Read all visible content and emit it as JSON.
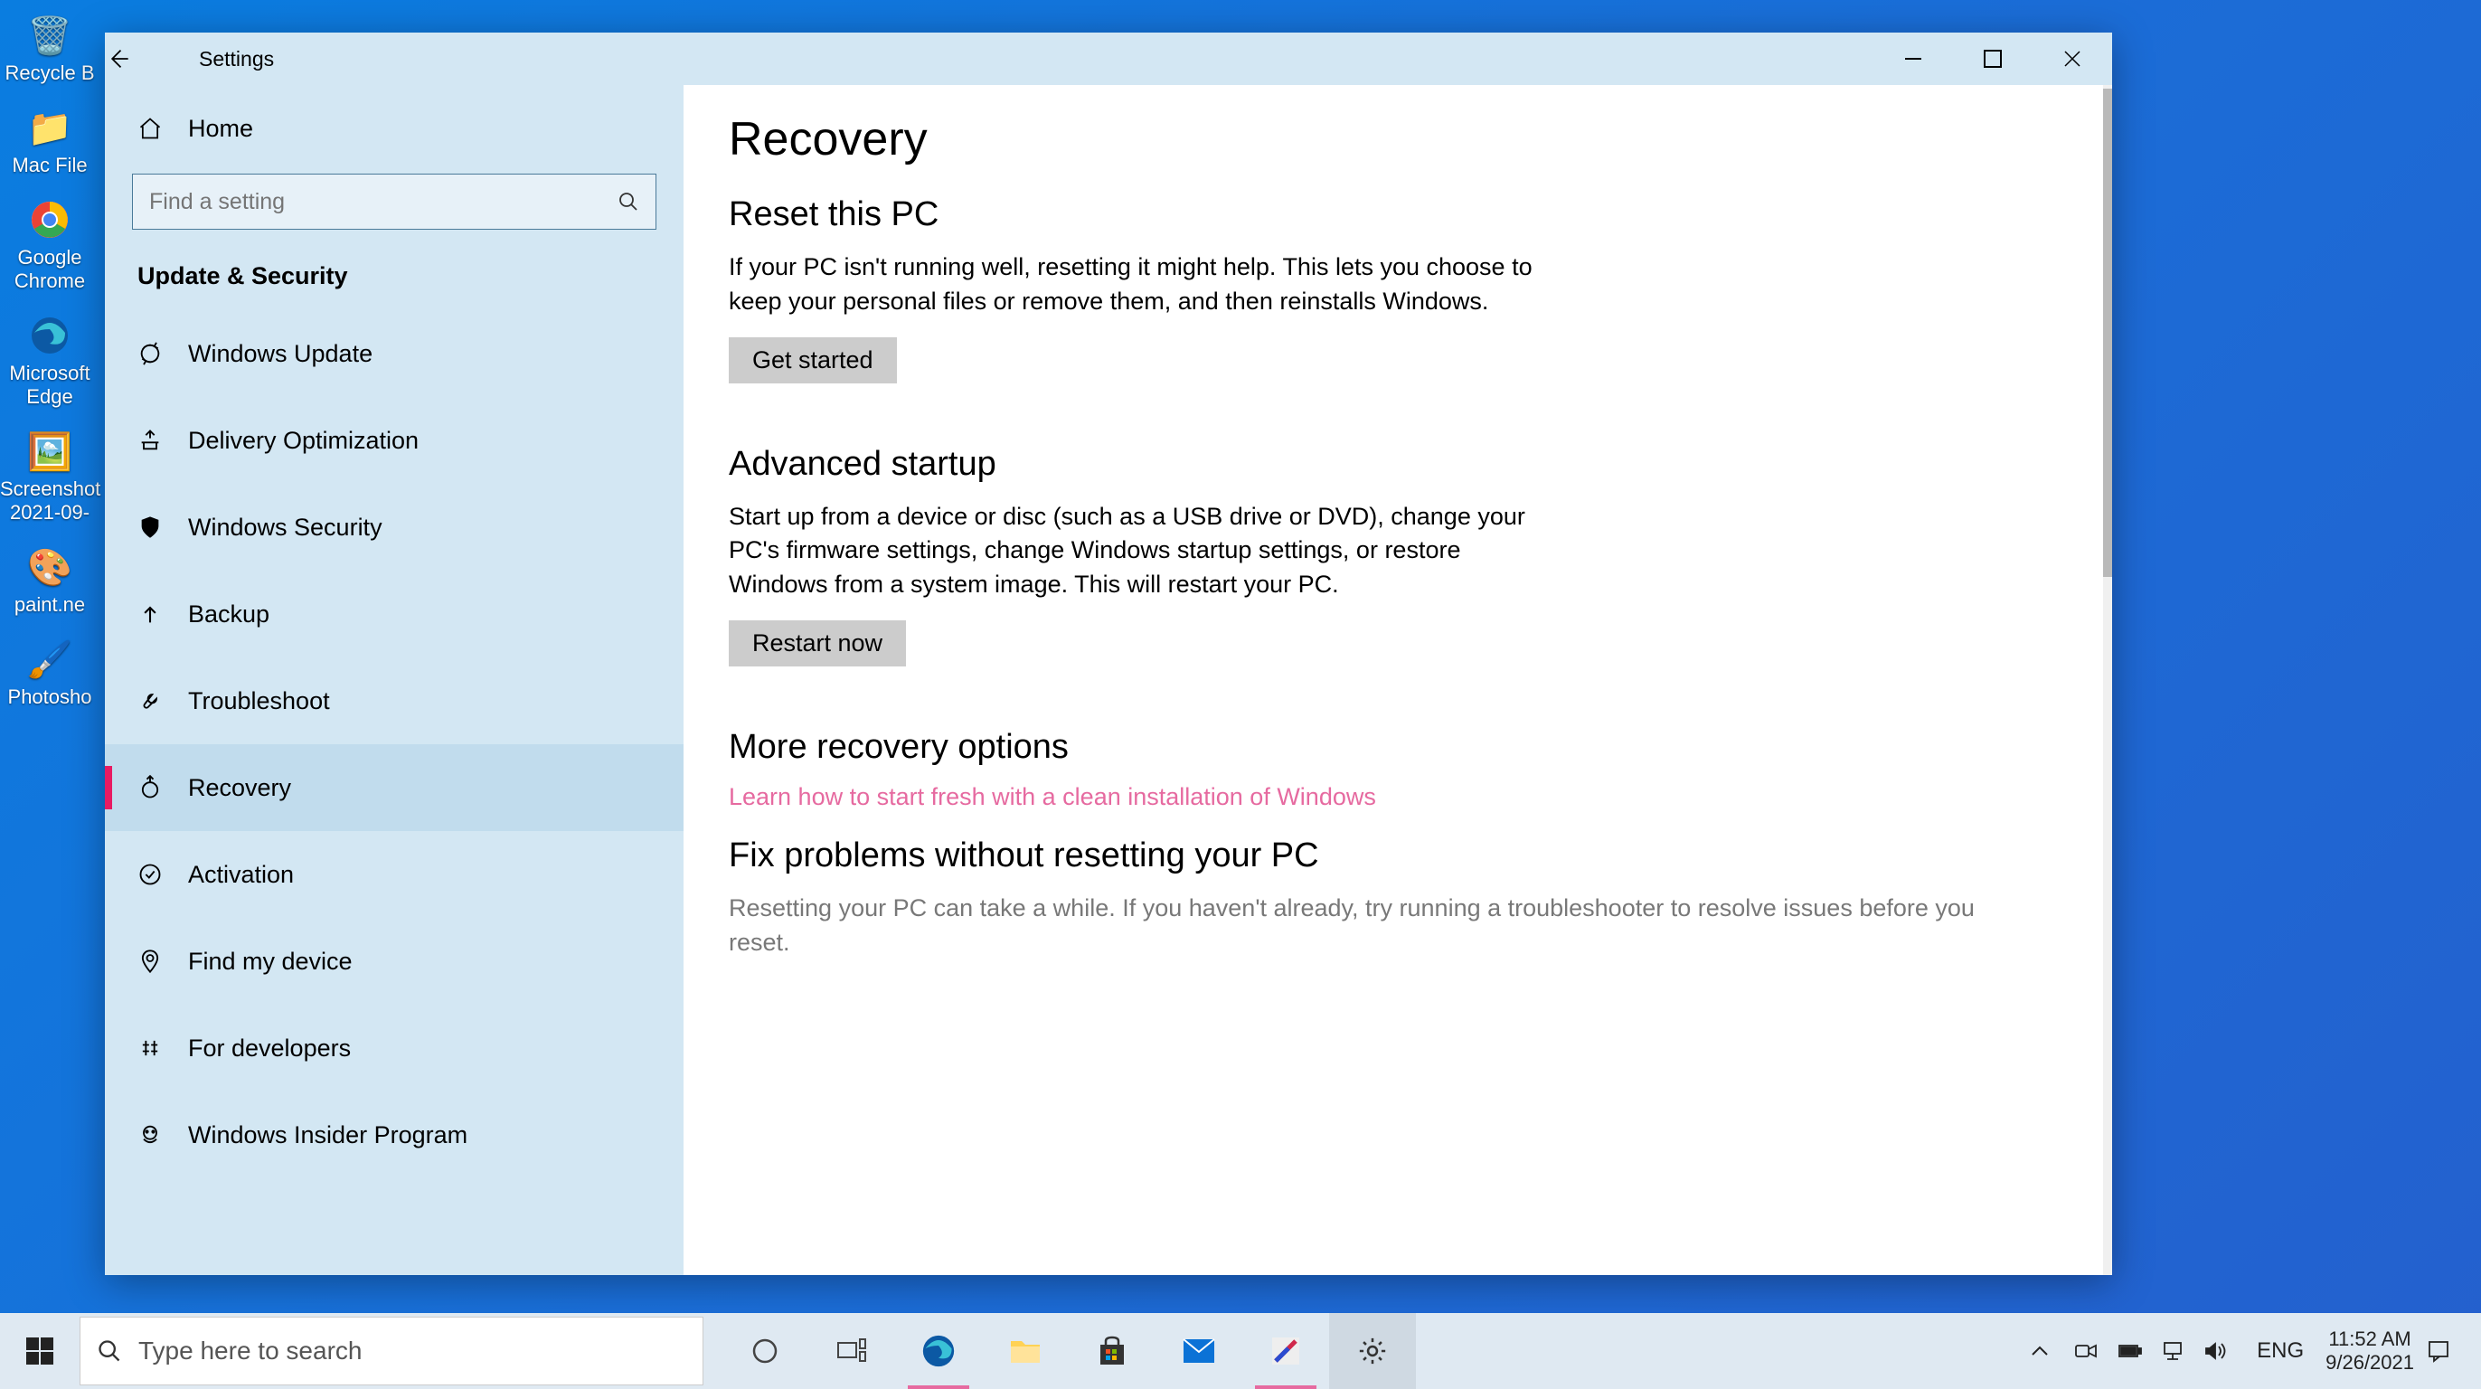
{
  "desktop_icons": [
    {
      "label": "Recycle B"
    },
    {
      "label": "Mac File"
    },
    {
      "label": "Google Chrome"
    },
    {
      "label": "Microsoft Edge"
    },
    {
      "label": "Screenshot 2021-09-"
    },
    {
      "label": "paint.ne"
    },
    {
      "label": "Photosho"
    }
  ],
  "window": {
    "title": "Settings",
    "sidebar": {
      "home": "Home",
      "search_placeholder": "Find a setting",
      "category": "Update & Security",
      "items": [
        {
          "label": "Windows Update"
        },
        {
          "label": "Delivery Optimization"
        },
        {
          "label": "Windows Security"
        },
        {
          "label": "Backup"
        },
        {
          "label": "Troubleshoot"
        },
        {
          "label": "Recovery"
        },
        {
          "label": "Activation"
        },
        {
          "label": "Find my device"
        },
        {
          "label": "For developers"
        },
        {
          "label": "Windows Insider Program"
        }
      ]
    },
    "content": {
      "page_title": "Recovery",
      "reset_heading": "Reset this PC",
      "reset_text": "If your PC isn't running well, resetting it might help. This lets you choose to keep your personal files or remove them, and then reinstalls Windows.",
      "reset_button": "Get started",
      "advanced_heading": "Advanced startup",
      "advanced_text": "Start up from a device or disc (such as a USB drive or DVD), change your PC's firmware settings, change Windows startup settings, or restore Windows from a system image. This will restart your PC.",
      "advanced_button": "Restart now",
      "more_heading": "More recovery options",
      "more_link": "Learn how to start fresh with a clean installation of Windows",
      "fix_heading": "Fix problems without resetting your PC",
      "fix_text": "Resetting your PC can take a while. If you haven't already, try running a troubleshooter to resolve issues before you reset."
    }
  },
  "taskbar": {
    "search_placeholder": "Type here to search",
    "lang": "ENG",
    "time": "11:52 AM",
    "date": "9/26/2021"
  }
}
